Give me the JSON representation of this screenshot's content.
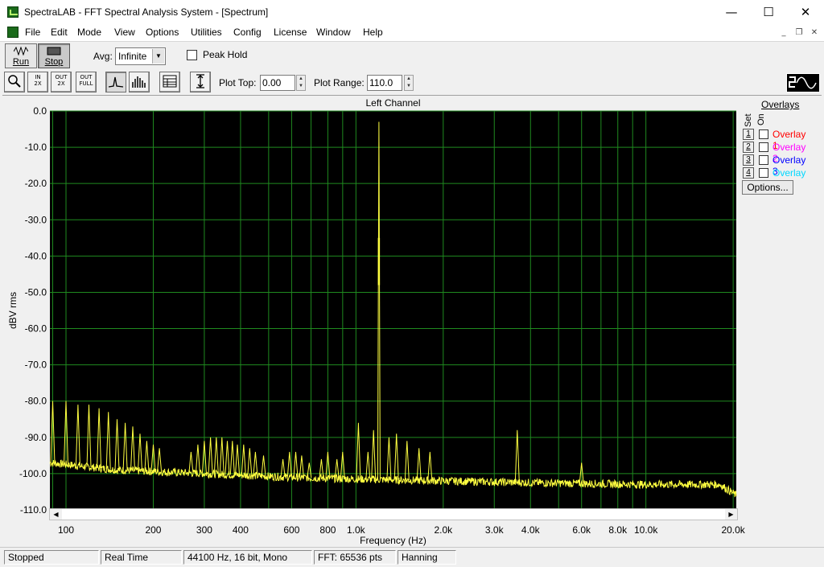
{
  "window": {
    "title": "SpectraLAB - FFT Spectral Analysis System - [Spectrum]",
    "controls": [
      "—",
      "☐",
      "✕"
    ]
  },
  "menu": [
    "File",
    "Edit",
    "Mode",
    "View",
    "Options",
    "Utilities",
    "Config",
    "License",
    "Window",
    "Help"
  ],
  "toolbar": {
    "run_label": "Run",
    "stop_label": "Stop",
    "avg_label": "Avg:",
    "avg_value": "Infinite",
    "peak_hold_label": "Peak Hold",
    "peak_hold_checked": false,
    "plot_top_label": "Plot Top:",
    "plot_top_value": "0.00",
    "plot_range_label": "Plot Range:",
    "plot_range_value": "110.0"
  },
  "icons": {
    "zoom": "magnifier-icon",
    "zoom_in": "zoom-in-2x-icon",
    "zoom_out": "zoom-out-2x-icon",
    "zoom_full": "zoom-out-full-icon",
    "line_mode": "line-plot-icon",
    "bar_mode": "bar-plot-icon",
    "table": "table-icon",
    "scale": "scale-icon",
    "logo": "sine-square-logo-icon"
  },
  "zoom_buttons": {
    "in_top": "IN",
    "in_bottom": "2X",
    "out_top": "OUT",
    "out_bottom": "2X",
    "full_top": "OUT",
    "full_bottom": "FULL"
  },
  "overlays": {
    "header": "Overlays",
    "set_label": "Set",
    "on_label": "On",
    "items": [
      {
        "num": "1",
        "label": "Overlay 1",
        "color": "#ff0000"
      },
      {
        "num": "2",
        "label": "Overlay 2",
        "color": "#ff00ff"
      },
      {
        "num": "3",
        "label": "Overlay 3",
        "color": "#0000ff"
      },
      {
        "num": "4",
        "label": "Overlay 4",
        "color": "#00d8ff"
      }
    ],
    "options_label": "Options..."
  },
  "chart_data": {
    "type": "line",
    "title": "Left Channel",
    "xlabel": "Frequency (Hz)",
    "ylabel": "dBV rms",
    "x_scale": "log",
    "xlim": [
      88,
      20500
    ],
    "ylim": [
      -110,
      0
    ],
    "y_ticks": [
      "0.0",
      "-10.0",
      "-20.0",
      "-30.0",
      "-40.0",
      "-50.0",
      "-60.0",
      "-70.0",
      "-80.0",
      "-90.0",
      "-100.0",
      "-110.0"
    ],
    "x_ticks": [
      {
        "v": 100,
        "label": "100"
      },
      {
        "v": 200,
        "label": "200"
      },
      {
        "v": 300,
        "label": "300"
      },
      {
        "v": 400,
        "label": "400"
      },
      {
        "v": 600,
        "label": "600"
      },
      {
        "v": 800,
        "label": "800"
      },
      {
        "v": 1000,
        "label": "1.0k"
      },
      {
        "v": 2000,
        "label": "2.0k"
      },
      {
        "v": 3000,
        "label": "3.0k"
      },
      {
        "v": 4000,
        "label": "4.0k"
      },
      {
        "v": 6000,
        "label": "6.0k"
      },
      {
        "v": 8000,
        "label": "8.0k"
      },
      {
        "v": 10000,
        "label": "10.0k"
      },
      {
        "v": 20000,
        "label": "20.0k"
      }
    ],
    "grid": true,
    "background": "#000000",
    "grid_color": "#1f8a1f",
    "trace_color": "#ffff40",
    "noise_floor": [
      [
        88,
        -97
      ],
      [
        150,
        -99
      ],
      [
        300,
        -100
      ],
      [
        600,
        -101
      ],
      [
        1000,
        -101.5
      ],
      [
        2000,
        -102
      ],
      [
        4000,
        -102.5
      ],
      [
        10000,
        -103
      ],
      [
        18000,
        -103
      ],
      [
        20500,
        -106
      ]
    ],
    "peaks": [
      [
        90,
        -80
      ],
      [
        100,
        -80
      ],
      [
        110,
        -81
      ],
      [
        120,
        -81
      ],
      [
        130,
        -82
      ],
      [
        140,
        -83
      ],
      [
        150,
        -85
      ],
      [
        160,
        -86
      ],
      [
        170,
        -87
      ],
      [
        180,
        -89
      ],
      [
        190,
        -91
      ],
      [
        200,
        -92
      ],
      [
        210,
        -93
      ],
      [
        270,
        -94
      ],
      [
        285,
        -92
      ],
      [
        300,
        -91
      ],
      [
        315,
        -90
      ],
      [
        330,
        -90
      ],
      [
        345,
        -90
      ],
      [
        360,
        -91
      ],
      [
        375,
        -91
      ],
      [
        390,
        -92
      ],
      [
        410,
        -92
      ],
      [
        430,
        -93
      ],
      [
        450,
        -94
      ],
      [
        480,
        -95
      ],
      [
        560,
        -96
      ],
      [
        590,
        -94
      ],
      [
        620,
        -94
      ],
      [
        650,
        -95
      ],
      [
        690,
        -97
      ],
      [
        760,
        -96
      ],
      [
        800,
        -94
      ],
      [
        860,
        -96
      ],
      [
        900,
        -94
      ],
      [
        1020,
        -86
      ],
      [
        1100,
        -94
      ],
      [
        1150,
        -88
      ],
      [
        1200,
        -3
      ],
      [
        1300,
        -90
      ],
      [
        1380,
        -89
      ],
      [
        1500,
        -91
      ],
      [
        1650,
        -93
      ],
      [
        1800,
        -94
      ],
      [
        3600,
        -88
      ],
      [
        6000,
        -97
      ]
    ]
  },
  "status": {
    "state": "Stopped",
    "mode": "Real Time",
    "format": "44100 Hz, 16 bit, Mono",
    "fft": "FFT: 65536 pts",
    "window": "Hanning"
  }
}
